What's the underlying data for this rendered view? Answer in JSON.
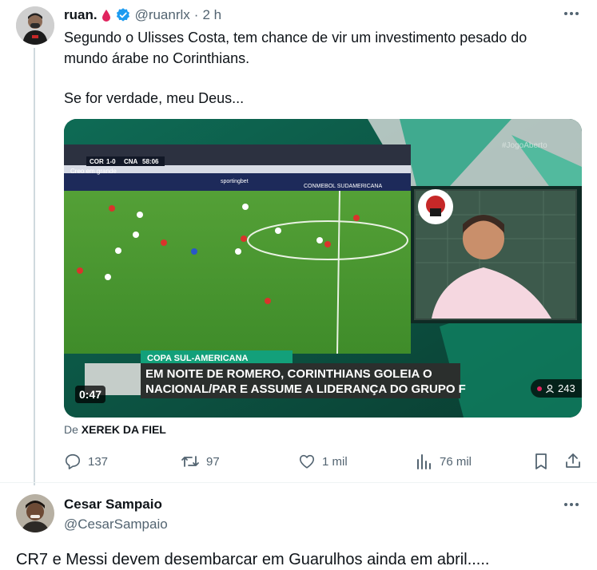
{
  "tweet": {
    "author_name": "ruan.",
    "handle": "@ruanrlx",
    "separator": "·",
    "time": "2 h",
    "text_line1": "Segundo o Ulisses Costa, tem chance de vir um investimento pesado do",
    "text_line2": "mundo árabe no Corinthians.",
    "text_line3": "Se for verdade, meu Deus...",
    "video": {
      "scoreboard": {
        "home": "COR",
        "score": "1-0",
        "away": "CNA",
        "clock": "58:06"
      },
      "watermark": "#JogoAberto",
      "banner_tag": "COPA SUL-AMERICANA",
      "headline_line1": "EM NOITE DE ROMERO, CORINTHIANS GOLEIA O",
      "headline_line2": "NACIONAL/PAR E ASSUME A LIDERANÇA DO GRUPO F",
      "duration": "0:47",
      "viewers": "243",
      "stadium_ad": "Creo em grande",
      "conmebol": "CONMEBOL SUDAMERICANA",
      "sporting": "sportingbet"
    },
    "source_prefix": "De",
    "source_name": "XEREK DA FIEL",
    "actions": {
      "replies": "137",
      "retweets": "97",
      "likes": "1 mil",
      "views": "76 mil"
    }
  },
  "reply": {
    "author_name": "Cesar Sampaio",
    "handle": "@CesarSampaio",
    "text": "CR7 e Messi devem desembarcar em Guarulhos ainda em abril....."
  },
  "icons": [
    "blood-drop-icon",
    "verified-badge-icon",
    "more-icon",
    "reply-icon",
    "retweet-icon",
    "like-icon",
    "views-icon",
    "bookmark-icon",
    "share-icon",
    "person-icon"
  ],
  "colors": {
    "accent": "#1d9bf0",
    "muted": "#536471",
    "drop": "#e0245e"
  }
}
